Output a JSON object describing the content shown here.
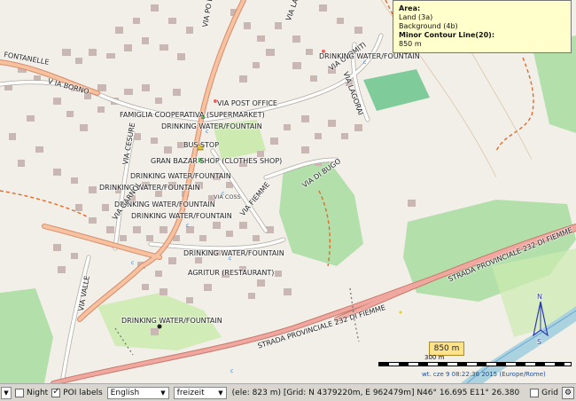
{
  "info_panel": {
    "area_heading": "Area:",
    "area_line1": "Land (3a)",
    "area_line2": "Background (4b)",
    "contour_heading": "Minor Contour Line(20):",
    "contour_value": "850 m"
  },
  "map": {
    "labels": {
      "via_po_ligo": "VIA PO LIGO",
      "via_lat": "VIA LA",
      "via_olomiti": "VIA OLOMITI",
      "via_lagorai": "VIA LAGORAI",
      "drinking_water_top": "DRINKING WATER/FOUNTAIN",
      "fontanelle": "FONTANELLE",
      "via_borno": "V IA BORNO",
      "post_office": "VIA POST OFFICE",
      "famiglia": "FAMIGLIA COOPERATIVA (SUPERMARKET)",
      "drinking_water_1": "DRINKING WATER/FOUNTAIN",
      "via_cesure": "VIA CESURE",
      "bus_stop": "BUS STOP",
      "gran_bazar": "GRAN BAZAR SHOP (CLOTHES SHOP)",
      "drinking_water_2": "DRINKING WATER/FOUNTAIN",
      "drinking_water_3": "DRINKING WATER/FOUNTAIN",
      "via_di_bugo": "VIA DI BUGO",
      "via_coss": "VIA COSS",
      "via_fiemme": "VIA FIEMME",
      "drinking_water_4": "DRINKING WATER/FOUNTAIN",
      "via_garnol": "VIA GARNOL",
      "drinking_water_5": "DRINKING WATER/FOUNTAIN",
      "drinking_water_6": "DRINKING WATER/FOUNTAIN",
      "agritur": "AGRITUR (RESTAURANT)",
      "via_valle": "VIA VALLE",
      "drinking_water_7": "DRINKING WATER/FOUNTAIN",
      "strada_1": "STRADA PROVINCIALE 232 DI FIEMME",
      "strada_2": "STRADA PROVINCIALE 232 DI FIEMME"
    },
    "elevation_badge": "850 m",
    "scale_label": "300 m",
    "credit": "wt. cze  9 08:22:36 2015 (Europe/Rome)",
    "compass_n": "N",
    "compass_s": "S"
  },
  "statusbar": {
    "night_label": "Night",
    "night_checked": false,
    "poi_label": "POI labels",
    "poi_checked": true,
    "language_value": "English",
    "style_value": "freizeit",
    "coords": "(ele: 823 m) [Grid: N 4379220m, E 962479m] N46° 16.695 E11° 26.380",
    "grid_label": "Grid",
    "grid_checked": false
  }
}
